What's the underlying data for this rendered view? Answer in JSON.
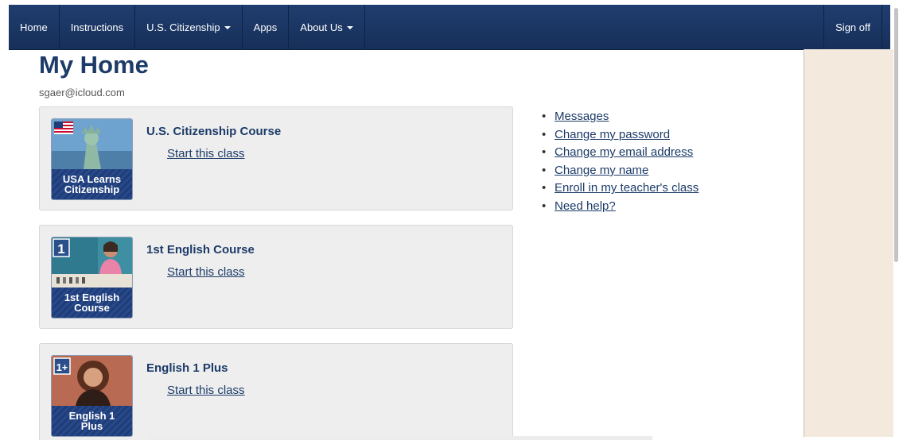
{
  "nav": {
    "items": [
      {
        "label": "Home",
        "caret": false
      },
      {
        "label": "Instructions",
        "caret": false
      },
      {
        "label": "U.S. Citizenship",
        "caret": true
      },
      {
        "label": "Apps",
        "caret": false
      },
      {
        "label": "About Us",
        "caret": true
      }
    ],
    "sign_off": "Sign off",
    "bg_color": "#1f3d6e"
  },
  "page": {
    "title": "My Home",
    "email": "sgaer@icloud.com"
  },
  "courses": [
    {
      "title": "U.S. Citizenship Course",
      "link": "Start this class",
      "thumb_line1": "USA Learns",
      "thumb_line2": "Citizenship"
    },
    {
      "title": "1st English Course",
      "link": "Start this class",
      "thumb_line1": "1st English",
      "thumb_line2": "Course",
      "badge": "1"
    },
    {
      "title": "English 1 Plus",
      "link": "Start this class",
      "thumb_line1": "English 1",
      "thumb_line2": "Plus",
      "badge": "1+"
    }
  ],
  "links": [
    "Messages",
    "Change my password",
    "Change my email address",
    "Change my name",
    "Enroll in my teacher's class",
    "Need help?"
  ],
  "colors": {
    "link": "#1c3b68",
    "panel": "#f3e9dc",
    "card": "#eeeeee"
  }
}
